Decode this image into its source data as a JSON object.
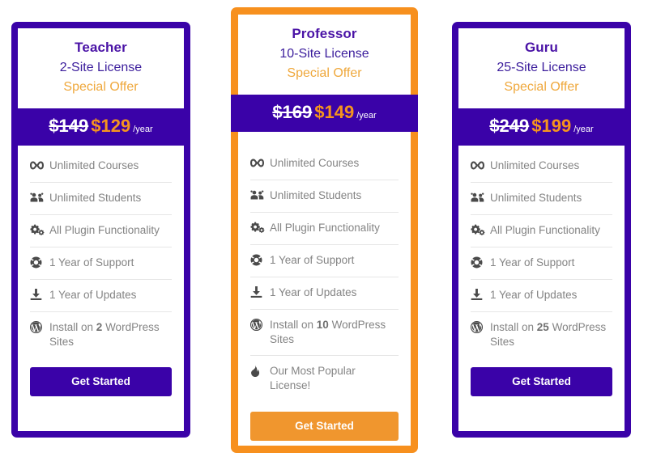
{
  "colors": {
    "purple": "#3a02a8",
    "orange": "#f7901e",
    "gold": "#efa83c",
    "feature_text": "#848484"
  },
  "plans": [
    {
      "id": "teacher",
      "name": "Teacher",
      "sites_label": "2-Site License",
      "offer_label": "Special Offer",
      "price_old": "$149",
      "price_new": "$129",
      "price_period": "/year",
      "features": [
        {
          "icon": "infinity-icon",
          "text": "Unlimited Courses"
        },
        {
          "icon": "users-icon",
          "text": "Unlimited Students"
        },
        {
          "icon": "gears-icon",
          "text": "All Plugin Functionality"
        },
        {
          "icon": "lifebuoy-icon",
          "text": "1 Year of Support"
        },
        {
          "icon": "download-icon",
          "text": "1 Year of Updates"
        },
        {
          "icon": "wordpress-icon",
          "text_pre": "Install on ",
          "text_bold": "2",
          "text_post": " WordPress Sites"
        }
      ],
      "cta_label": "Get Started"
    },
    {
      "id": "professor",
      "name": "Professor",
      "sites_label": "10-Site License",
      "offer_label": "Special Offer",
      "price_old": "$169",
      "price_new": "$149",
      "price_period": "/year",
      "features": [
        {
          "icon": "infinity-icon",
          "text": "Unlimited Courses"
        },
        {
          "icon": "users-icon",
          "text": "Unlimited Students"
        },
        {
          "icon": "gears-icon",
          "text": "All Plugin Functionality"
        },
        {
          "icon": "lifebuoy-icon",
          "text": "1 Year of Support"
        },
        {
          "icon": "download-icon",
          "text": "1 Year of Updates"
        },
        {
          "icon": "wordpress-icon",
          "text_pre": "Install on ",
          "text_bold": "10",
          "text_post": " WordPress Sites"
        },
        {
          "icon": "fire-icon",
          "text": "Our Most Popular License!"
        }
      ],
      "cta_label": "Get Started"
    },
    {
      "id": "guru",
      "name": "Guru",
      "sites_label": "25-Site License",
      "offer_label": "Special Offer",
      "price_old": "$249",
      "price_new": "$199",
      "price_period": "/year",
      "features": [
        {
          "icon": "infinity-icon",
          "text": "Unlimited Courses"
        },
        {
          "icon": "users-icon",
          "text": "Unlimited Students"
        },
        {
          "icon": "gears-icon",
          "text": "All Plugin Functionality"
        },
        {
          "icon": "lifebuoy-icon",
          "text": "1 Year of Support"
        },
        {
          "icon": "download-icon",
          "text": "1 Year of Updates"
        },
        {
          "icon": "wordpress-icon",
          "text_pre": "Install on ",
          "text_bold": "25",
          "text_post": " WordPress Sites"
        }
      ],
      "cta_label": "Get Started"
    }
  ]
}
